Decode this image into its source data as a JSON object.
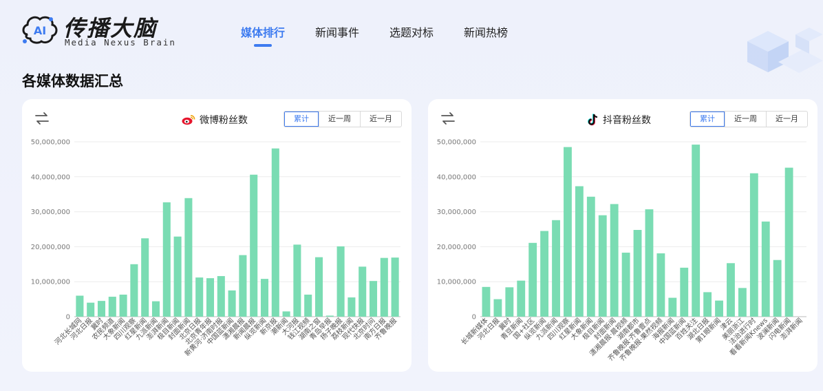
{
  "app": {
    "logo_text": "传播大脑",
    "logo_badge": "AI",
    "logo_subtitle": "Media Nexus Brain"
  },
  "nav": {
    "items": [
      {
        "label": "媒体排行",
        "active": true
      },
      {
        "label": "新闻事件",
        "active": false
      },
      {
        "label": "选题对标",
        "active": false
      },
      {
        "label": "新闻热榜",
        "active": false
      }
    ]
  },
  "section": {
    "title": "各媒体数据汇总"
  },
  "colors": {
    "accent": "#3d7bf0",
    "bar": "#7adcb3"
  },
  "cards": [
    {
      "title": "微博粉丝数",
      "icon": "weibo-icon",
      "tabs": [
        {
          "label": "累计",
          "active": true
        },
        {
          "label": "近一周",
          "active": false
        },
        {
          "label": "近一月",
          "active": false
        }
      ]
    },
    {
      "title": "抖音粉丝数",
      "icon": "douyin-icon",
      "tabs": [
        {
          "label": "累计",
          "active": true
        },
        {
          "label": "近一周",
          "active": false
        },
        {
          "label": "近一月",
          "active": false
        }
      ]
    }
  ],
  "chart_data": [
    {
      "type": "bar",
      "title": "微博粉丝数",
      "ylim": [
        0,
        50000000
      ],
      "yticks": [
        "0",
        "10,000,000",
        "20,000,000",
        "30,000,000",
        "40,000,000",
        "50,000,000"
      ],
      "grid": true,
      "categories": [
        "河北长城网",
        "河北日报",
        "冀时",
        "农民频道",
        "大象新闻",
        "四川观察",
        "红星新闻",
        "九派新闻",
        "澎湃新闻",
        "极目新闻",
        "封面新闻",
        "北京日报",
        "北京青年报",
        "新黄河·济南时报",
        "中国蓝新闻",
        "潇湘晨报",
        "新闻晨报",
        "纵览新闻",
        "新京报",
        "潮新闻",
        "大河报",
        "钱江视频",
        "湖南之窗",
        "青岛早报",
        "扬子晚报",
        "荔枝新闻",
        "现代快报",
        "北京时间",
        "南方日报",
        "齐鲁晚报"
      ],
      "values": [
        6000000,
        4000000,
        4500000,
        5700000,
        6300000,
        15000000,
        22400000,
        4400000,
        32700000,
        22900000,
        33900000,
        11200000,
        11000000,
        11600000,
        7500000,
        17600000,
        40600000,
        10800000,
        48100000,
        1500000,
        20600000,
        6300000,
        17000000,
        300000,
        20100000,
        5500000,
        14300000,
        10200000,
        16800000,
        16900000
      ]
    },
    {
      "type": "bar",
      "title": "抖音粉丝数",
      "ylim": [
        0,
        50000000
      ],
      "yticks": [
        "0",
        "10,000,000",
        "20,000,000",
        "30,000,000",
        "40,000,000",
        "50,000,000"
      ],
      "grid": true,
      "categories": [
        "长城新媒体",
        "河北日报",
        "冀时",
        "青豆新闻",
        "国+社区",
        "纵览新闻",
        "九派新闻",
        "四川观察",
        "红星新闻",
        "大象新闻",
        "极目新闻",
        "封面新闻",
        "潇湘晨报·晨视频",
        "湖南都市",
        "齐鲁晚报·齐鲁壹点",
        "齐鲁晚报·果然视频",
        "海报新闻",
        "中国蓝新闻",
        "百姓关注",
        "湖北日报",
        "第1眼新闻",
        "津云",
        "美丽浙江",
        "法治进行时",
        "看看新闻Knews",
        "波澜新闻",
        "闪电新闻",
        "澎湃新闻"
      ],
      "values": [
        8500000,
        5000000,
        8400000,
        10300000,
        21100000,
        24500000,
        27600000,
        48500000,
        37300000,
        34300000,
        29000000,
        32200000,
        18300000,
        24800000,
        30700000,
        18100000,
        5400000,
        14000000,
        49200000,
        7000000,
        4600000,
        15300000,
        8200000,
        41000000,
        27200000,
        16200000,
        42600000,
        0
      ]
    }
  ]
}
